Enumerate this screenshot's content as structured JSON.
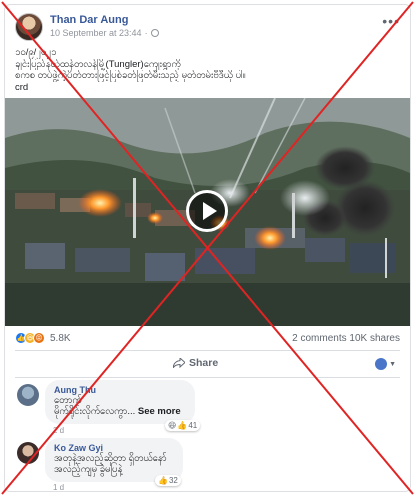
{
  "post": {
    "author": "Than Dar Aung",
    "timestamp": "10 September at 23:44",
    "visibility_icon": "globe-icon",
    "more_icon": "more-options-icon",
    "more_label": "•••",
    "caption_lines": [
      "၁၀/၉/၂၀၂၁",
      "ချင်းပြည်နယ်ထန်တလန်မြို့(Tungler)ကျေးရွာကို",
      "စကစ တပ်ဖွဲ့ကဲ့ပိတ်တားဖြင့်ပြစ်ခတ်ဖြတ်မီးသည့် မှတ်တမ်းဗီဒီယို ပါ။",
      "crd"
    ]
  },
  "video": {
    "play_icon": "play-icon"
  },
  "reactions": {
    "icons": [
      "like-icon",
      "haha-icon",
      "angry-icon"
    ],
    "count": "5.8K",
    "comments": "2 comments",
    "shares": "10K shares"
  },
  "actions": {
    "share_label": "Share",
    "share_icon": "share-icon",
    "audience_icon": "audience-selector-icon"
  },
  "comments": [
    {
      "name": "Aung Thu",
      "lines": [
        "တောက်",
        "မိုက်ရိုင်းလိုက်လေကွာ..."
      ],
      "see_more": "See more",
      "reaction_count": "41",
      "time": "2 d"
    },
    {
      "name": "Ko Zaw Gyi",
      "lines": [
        "အတုနဲ့အလည့်ဆိုတာ ရှိတယ်နော်",
        "အလည့်ကျမှ ခွဲမပြနဲ့"
      ],
      "reaction_count": "32",
      "time": "1 d"
    }
  ],
  "colors": {
    "link": "#385898",
    "x_mark": "#e02424"
  }
}
